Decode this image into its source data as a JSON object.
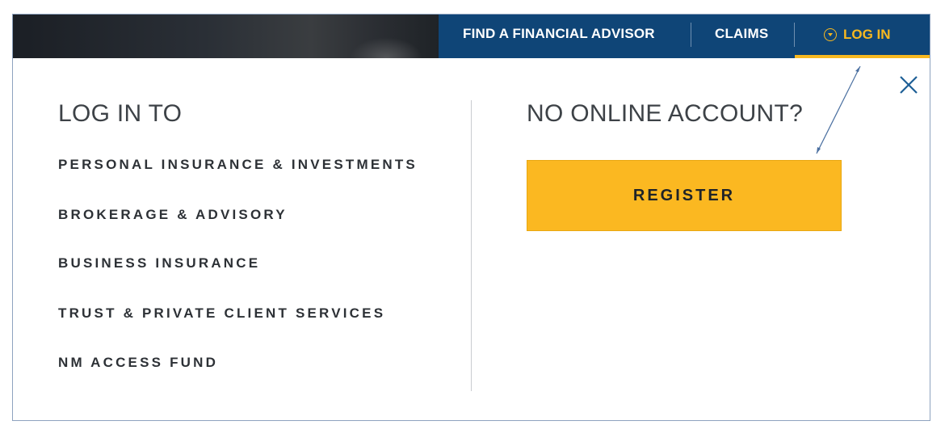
{
  "nav": {
    "advisor_label": "FIND A FINANCIAL ADVISOR",
    "claims_label": "CLAIMS",
    "login_label": "LOG IN",
    "login_icon": "chevron-circle-down-icon"
  },
  "login_panel": {
    "heading": "LOG IN TO",
    "items": [
      "PERSONAL INSURANCE & INVESTMENTS",
      "BROKERAGE & ADVISORY",
      "BUSINESS INSURANCE",
      "TRUST & PRIVATE CLIENT SERVICES",
      "NM ACCESS FUND"
    ]
  },
  "register_panel": {
    "heading": "NO ONLINE ACCOUNT?",
    "register_label": "REGISTER"
  },
  "close_icon": "close-icon",
  "colors": {
    "nav_background": "#0f4577",
    "accent_yellow": "#fbb821",
    "login_highlight": "#f7b820",
    "text_dark": "#2d3136"
  }
}
